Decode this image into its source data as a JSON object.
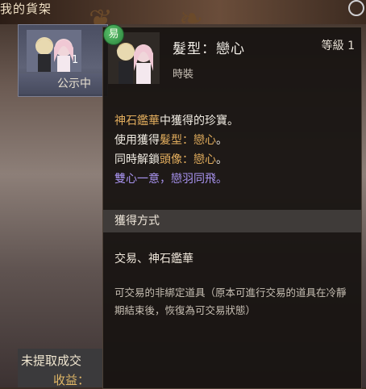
{
  "background": {
    "title": "我的貨架",
    "left_card": {
      "quantity": "1",
      "status_label": "公示中"
    },
    "bottom_panel": {
      "unclaimed_label": "未提取成交",
      "earnings_label": "收益："
    }
  },
  "tooltip": {
    "trade_badge": "易",
    "item_name": "髮型：戀心",
    "item_level": "等級 1",
    "item_type": "時裝",
    "desc": {
      "line1_source": "神石鑑華",
      "line1_rest": "中獲得的珍寶。",
      "line2_prefix": "使用獲得",
      "line2_category": "髮型",
      "line2_sep": "：",
      "line2_item": "戀心",
      "line2_end": "。",
      "line3_prefix": "同時解鎖",
      "line3_category": "頭像",
      "line3_sep": "：",
      "line3_item": "戀心",
      "line3_end": "。",
      "flavor": "雙心一意，戀羽同飛。"
    },
    "obtain_header": "獲得方式",
    "obtain_methods": "交易、神石鑑華",
    "trade_note": "可交易的非綁定道具（原本可進行交易的道具在冷靜期結束後，恢復為可交易狀態）"
  },
  "colors": {
    "gold_text": "#e2ad5d",
    "purple_text": "#a893ef",
    "badge_green": "#3e9a4d"
  }
}
